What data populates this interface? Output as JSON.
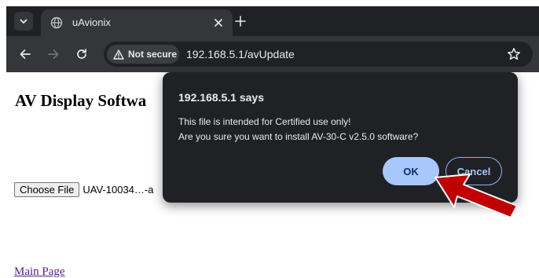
{
  "browser": {
    "tab_title": "uAvionix",
    "security_label": "Not secure",
    "url": "192.168.5.1/avUpdate"
  },
  "page": {
    "heading": "AV Display Softwa",
    "choose_file_label": "Choose File",
    "file_name": "UAV-10034…-a",
    "main_page_link": "Main Page"
  },
  "dialog": {
    "title": "192.168.5.1 says",
    "message_line1": "This file is intended for Certified use only!",
    "message_line2": "Are you sure you want to install AV-30-C v2.5.0 software?",
    "ok_label": "OK",
    "cancel_label": "Cancel"
  },
  "colors": {
    "annotation_arrow": "#c00000",
    "ok_button": "#a8c7fa",
    "dialog_bg": "#202124"
  }
}
